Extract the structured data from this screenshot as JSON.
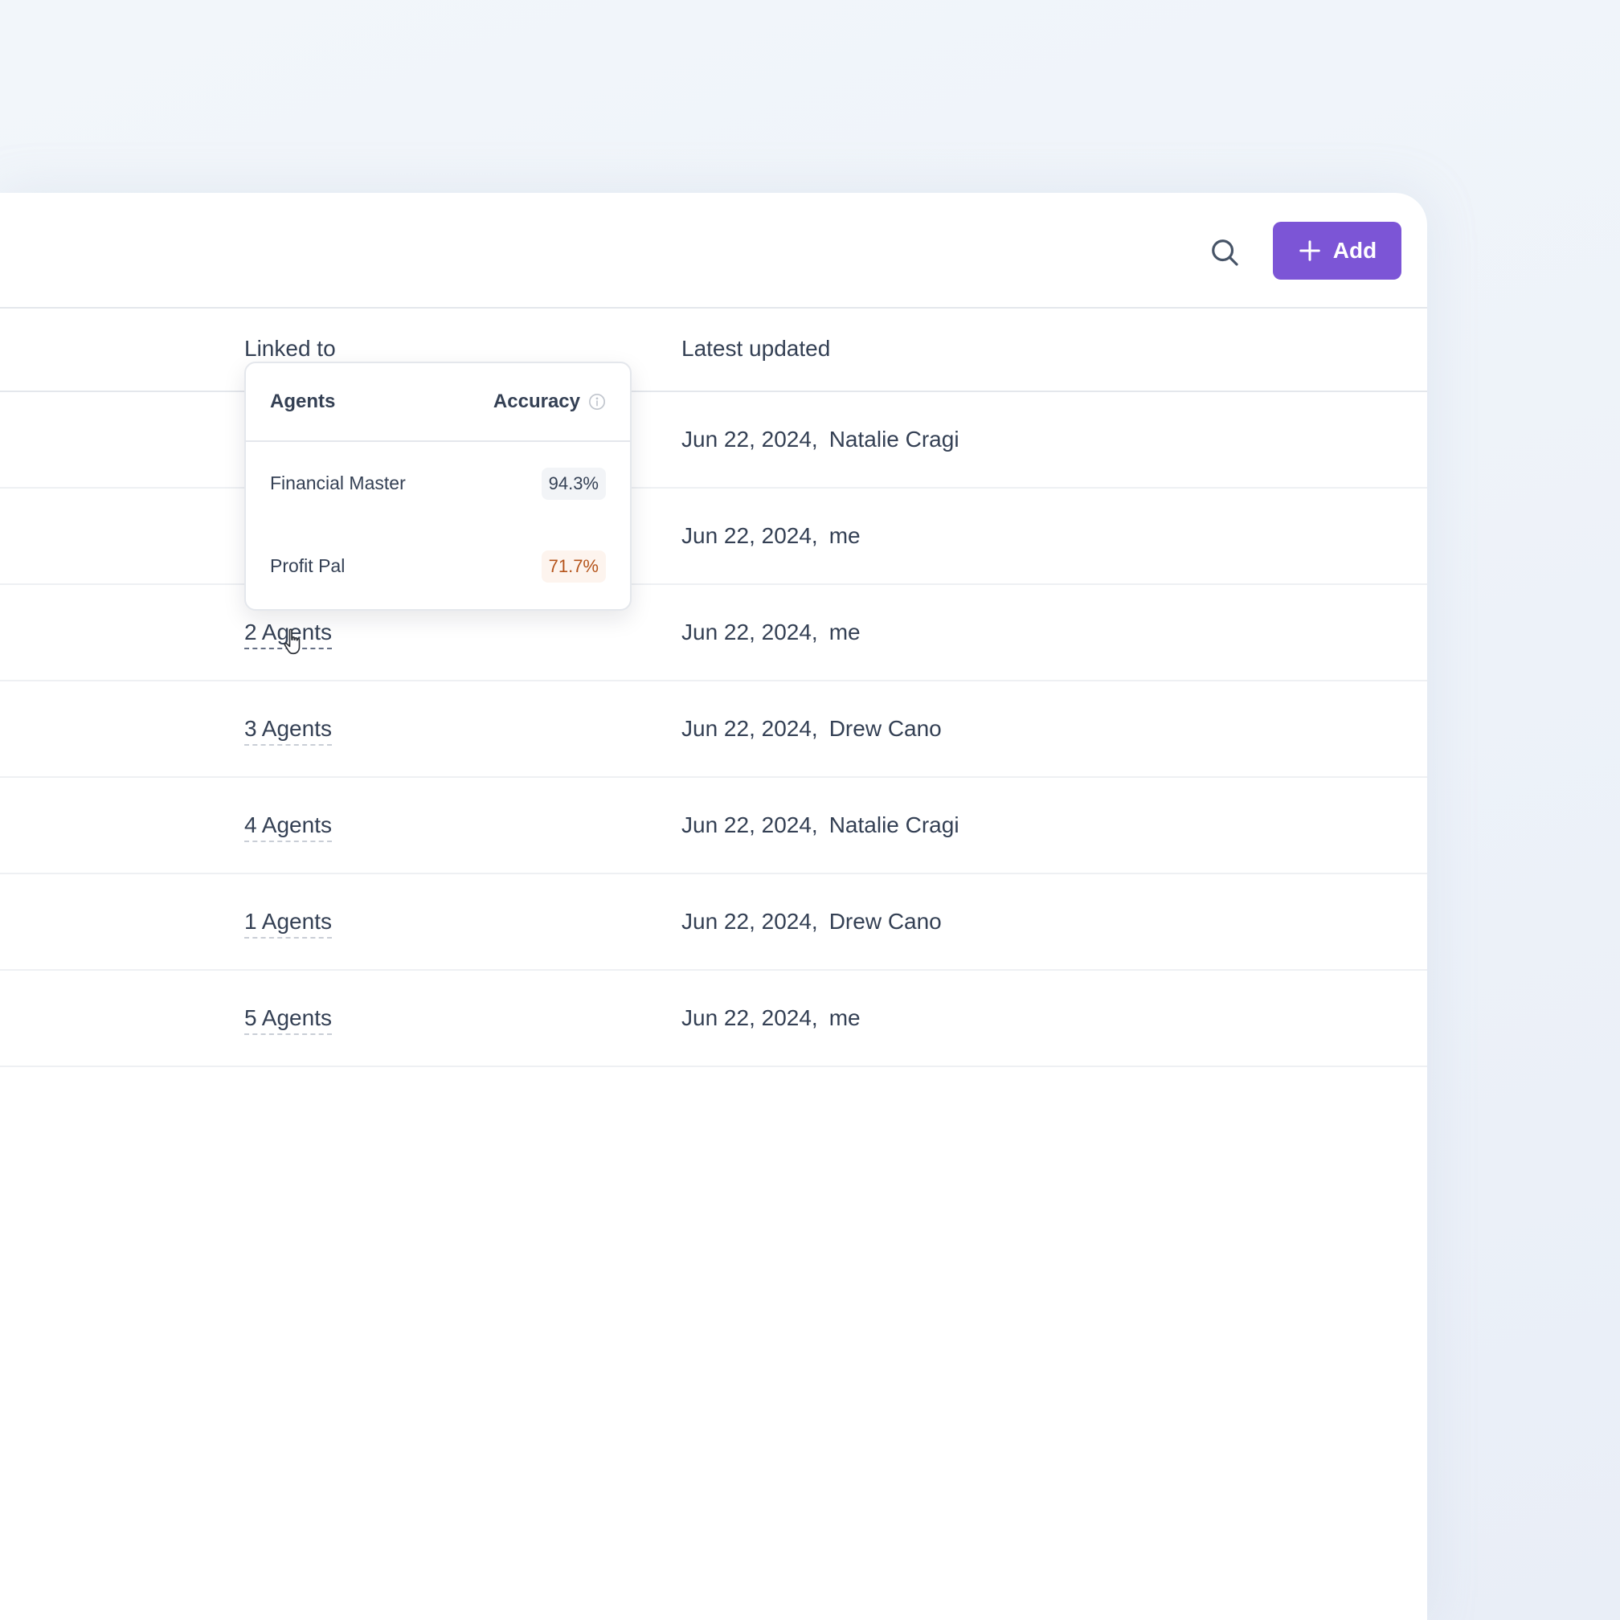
{
  "toolbar": {
    "search_icon": "search-icon",
    "add_label": "Add",
    "add_icon": "plus-icon",
    "accent": "#7c55d6"
  },
  "table": {
    "columns": {
      "linked_to": "Linked to",
      "latest_updated": "Latest updated"
    },
    "rows": [
      {
        "agents": "",
        "date": "Jun 22, 2024,",
        "user": "Natalie Cragi"
      },
      {
        "agents": "",
        "date": "Jun 22, 2024,",
        "user": "me"
      },
      {
        "agents": "2 Agents",
        "date": "Jun 22, 2024,",
        "user": "me"
      },
      {
        "agents": "3 Agents",
        "date": "Jun 22, 2024,",
        "user": "Drew Cano"
      },
      {
        "agents": "4 Agents",
        "date": "Jun 22, 2024,",
        "user": "Natalie Cragi"
      },
      {
        "agents": "1 Agents",
        "date": "Jun 22, 2024,",
        "user": "Drew Cano"
      },
      {
        "agents": "5 Agents",
        "date": "Jun 22, 2024,",
        "user": "me"
      }
    ]
  },
  "popover": {
    "col_agents": "Agents",
    "col_accuracy": "Accuracy",
    "info_icon": "info-icon",
    "items": [
      {
        "name": "Financial Master",
        "accuracy": "94.3%",
        "status_color": "#344054"
      },
      {
        "name": "Profit Pal",
        "accuracy": "71.7%",
        "status_color": "#b5541b"
      }
    ]
  }
}
